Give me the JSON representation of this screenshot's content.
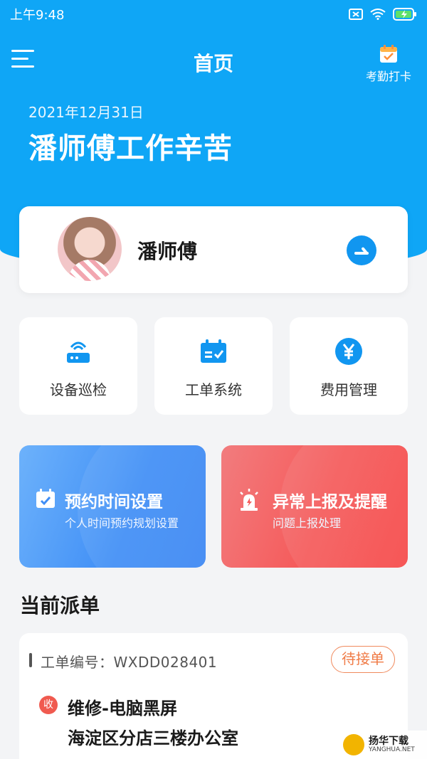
{
  "status_bar": {
    "time": "上午9:48"
  },
  "nav": {
    "title": "首页",
    "clockin_label": "考勤打卡"
  },
  "hero": {
    "date": "2021年12月31日",
    "greeting": "潘师傅工作辛苦"
  },
  "profile": {
    "name": "潘师傅"
  },
  "tiles": [
    {
      "label": "设备巡检",
      "icon": "router-icon"
    },
    {
      "label": "工单系统",
      "icon": "calendar-check-icon"
    },
    {
      "label": "费用管理",
      "icon": "yen-icon"
    }
  ],
  "banners": [
    {
      "title": "预约时间设置",
      "subtitle": "个人时间预约规划设置",
      "icon": "calendar-check-icon",
      "color": "#3f8ef6"
    },
    {
      "title": "异常上报及提醒",
      "subtitle": "问题上报处理",
      "icon": "alarm-icon",
      "color": "#f55a5a"
    }
  ],
  "section": {
    "current_orders_title": "当前派单"
  },
  "order": {
    "number_label": "工单编号：WXDD028401",
    "status": "待接单",
    "tag": "收",
    "title": "维修-电脑黑屏",
    "address": "海淀区分店三楼办公室"
  },
  "watermark": {
    "title": "扬华下载",
    "sub": "YANGHUA.NET"
  },
  "colors": {
    "primary": "#0fa6f6",
    "accent_orange": "#f07a45",
    "danger": "#f05a4f"
  }
}
